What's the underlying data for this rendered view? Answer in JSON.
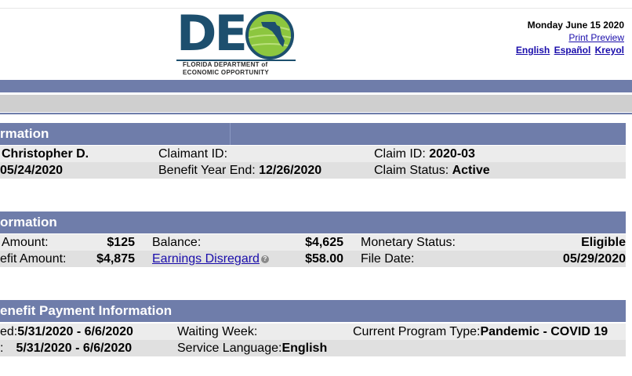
{
  "logo": {
    "letters": "DE",
    "tagline_1": "FLORIDA DEPARTMENT of",
    "tagline_2": "ECONOMIC OPPORTUNITY"
  },
  "header": {
    "date": "Monday June 15 2020",
    "print_preview": "Print Preview",
    "languages": [
      "English",
      "Español",
      "Kreyol"
    ]
  },
  "colors": {
    "section_header": "#6f7daa",
    "link": "#1a0dab",
    "logo_blue": "#1d4f6e",
    "globe_green": "#8cc63f"
  },
  "claimant": {
    "header": "rmation",
    "name": "Christopher D.",
    "claimant_id_label": "Claimant ID:",
    "claim_id_label": "Claim ID:",
    "claim_id_value": "2020-03",
    "effective_date": "05/24/2020",
    "benefit_year_end_label": "Benefit Year End:",
    "benefit_year_end_value": "12/26/2020",
    "claim_status_label": "Claim Status:",
    "claim_status_value": "Active"
  },
  "monetary": {
    "header": "ormation",
    "weekly_amount_label": "Amount:",
    "weekly_amount_value": "$125",
    "balance_label": "Balance:",
    "balance_value": "$4,625",
    "monetary_status_label": "Monetary Status:",
    "monetary_status_value": "Eligible",
    "max_benefit_label": "efit Amount:",
    "max_benefit_value": "$4,875",
    "earnings_disregard_label": "Earnings Disregard",
    "earnings_disregard_value": "$58.00",
    "file_date_label": "File Date:",
    "file_date_value": "05/29/2020"
  },
  "payment": {
    "header": "enefit Payment Information",
    "row1_label": "ed:",
    "row1_value": "5/31/2020 - 6/6/2020",
    "waiting_week_label": "Waiting Week:",
    "program_type_label": "Current Program Type:",
    "program_type_value": "Pandemic - COVID 19",
    "row2_label": ":",
    "row2_value": "5/31/2020 - 6/6/2020",
    "service_language_label": "Service Language:",
    "service_language_value": "English"
  }
}
